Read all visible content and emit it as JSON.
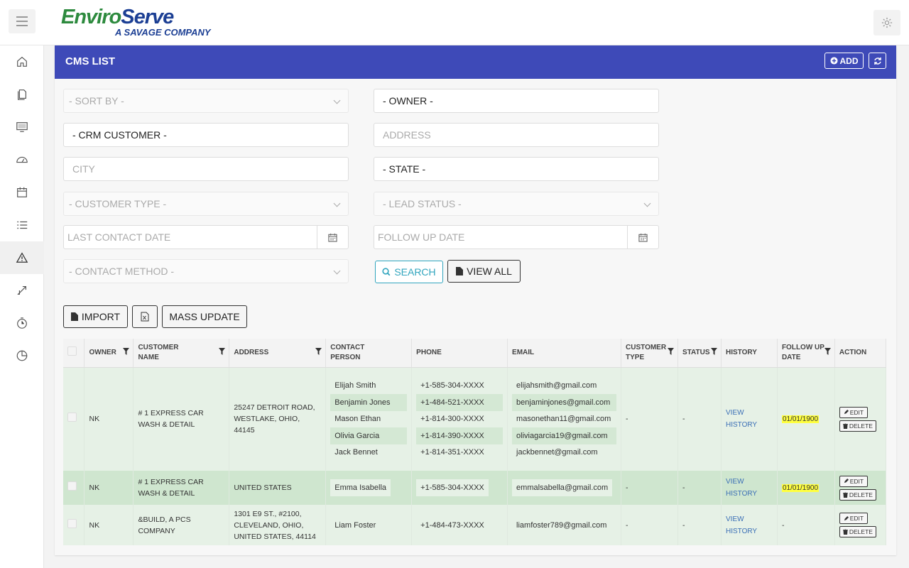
{
  "header": {
    "logo_brand_part1": "Enviro",
    "logo_brand_part2": "Serve",
    "logo_tagline": "A SAVAGE COMPANY"
  },
  "sidebar": {
    "items": [
      {
        "name": "home-icon"
      },
      {
        "name": "documents-icon"
      },
      {
        "name": "monitor-icon"
      },
      {
        "name": "dashboard-gauge-icon"
      },
      {
        "name": "calendar-icon"
      },
      {
        "name": "list-icon"
      },
      {
        "name": "warning-icon",
        "active": true
      },
      {
        "name": "arrows-icon"
      },
      {
        "name": "clock-icon"
      },
      {
        "name": "pie-chart-icon"
      }
    ]
  },
  "panel": {
    "title": "CMS LIST",
    "add_label": "ADD"
  },
  "filters": {
    "sort_by": "- SORT BY -",
    "owner": "- OWNER -",
    "crm_customer": "- CRM CUSTOMER -",
    "address_placeholder": "ADDRESS",
    "city_placeholder": "CITY",
    "state": "- STATE -",
    "customer_type": "- CUSTOMER TYPE -",
    "lead_status": "- LEAD STATUS -",
    "last_contact_placeholder": "LAST CONTACT DATE",
    "follow_up_placeholder": "FOLLOW UP DATE",
    "contact_method": "- CONTACT METHOD -",
    "search_label": "SEARCH",
    "view_all_label": "VIEW ALL"
  },
  "toolbar": {
    "import_label": "IMPORT",
    "mass_update_label": "MASS UPDATE"
  },
  "table": {
    "headers": {
      "owner": "OWNER",
      "customer_name_1": "CUSTOMER",
      "customer_name_2": "NAME",
      "address": "ADDRESS",
      "contact_1": "CONTACT",
      "contact_2": "PERSON",
      "phone": "PHONE",
      "email": "EMAIL",
      "ctype_1": "CUSTOMER",
      "ctype_2": "TYPE",
      "status": "STATUS",
      "history": "HISTORY",
      "followup_1": "FOLLOW UP",
      "followup_2": "DATE",
      "action": "ACTION"
    },
    "rows": [
      {
        "owner": "NK",
        "customer_name": "# 1 EXPRESS CAR WASH & DETAIL",
        "address": "25247 DETROIT ROAD, WESTLAKE, OHIO, 44145",
        "contacts": [
          "Elijah Smith",
          "Benjamin Jones",
          "Mason Ethan",
          "Olivia Garcia",
          "Jack Bennet"
        ],
        "phones": [
          "+1-585-304-XXXX",
          "+1-484-521-XXXX",
          "+1-814-300-XXXX",
          "+1-814-390-XXXX",
          "+1-814-351-XXXX"
        ],
        "emails": [
          "elijahsmith@gmail.com",
          "benjaminjones@gmail.com",
          "masonethan11@gmail.com",
          "oliviagarcia19@gmail.com",
          "jackbennet@gmail.com"
        ],
        "customer_type": "-",
        "status": "-",
        "history": "VIEW HISTORY",
        "follow_up": "01/01/1900",
        "edit": "EDIT",
        "delete": "DELETE"
      },
      {
        "owner": "NK",
        "customer_name": "# 1 EXPRESS CAR WASH & DETAIL",
        "address": "UNITED STATES",
        "contact": "Emma Isabella",
        "phone": "+1-585-304-XXXX",
        "email": "emmalsabella@gmail.com",
        "customer_type": "-",
        "status": "-",
        "history": "VIEW HISTORY",
        "follow_up": "01/01/1900",
        "edit": "EDIT",
        "delete": "DELETE"
      },
      {
        "owner": "NK",
        "customer_name": "&BUILD, A PCS COMPANY",
        "address": "1301 E9 ST., #2100, CLEVELAND, OHIO, UNITED STATES, 44114",
        "contact": "Liam Foster",
        "phone": "+1-484-473-XXXX",
        "email": "liamfoster789@gmail.com",
        "customer_type": "-",
        "status": "-",
        "history": "VIEW HISTORY",
        "follow_up": "-",
        "edit": "EDIT",
        "delete": "DELETE"
      }
    ]
  }
}
